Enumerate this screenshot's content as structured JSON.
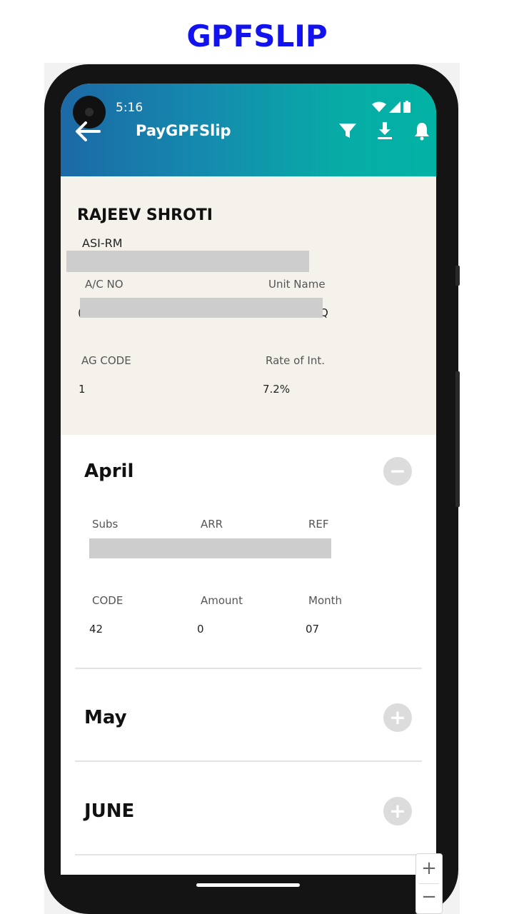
{
  "page_title": "GPFSLIP",
  "status_bar": {
    "time": "5:16"
  },
  "app_bar": {
    "title": "PayGPFSlip",
    "actions": [
      "filter-icon",
      "download-icon",
      "bell-icon"
    ]
  },
  "profile": {
    "name": "RAJEEV SHROTI",
    "rank": "ASI-RM",
    "ac_no_label": "A/C NO",
    "unit_name_label": "Unit Name",
    "ac_no_value_visible": "(",
    "unit_name_value_visible": "Q",
    "ag_code_label": "AG CODE",
    "ag_code_value": "1",
    "rate_label": "Rate of Int.",
    "rate_value": "7.2%"
  },
  "months": [
    {
      "name": "April",
      "expanded": true,
      "toggle": "−",
      "headers_row1": [
        "Subs",
        "ARR",
        "REF"
      ],
      "headers_row2": [
        "CODE",
        "Amount",
        "Month"
      ],
      "values_row2": [
        "42",
        "0",
        "07"
      ]
    },
    {
      "name": "May",
      "expanded": false,
      "toggle": "+"
    },
    {
      "name": "JUNE",
      "expanded": false,
      "toggle": "+"
    }
  ],
  "zoom": {
    "in": "+",
    "out": "−"
  },
  "colors": {
    "title_blue": "#1212ee",
    "appbar_start": "#1c69a6",
    "appbar_end": "#02b3a4",
    "profile_bg": "#f5f2ec"
  }
}
